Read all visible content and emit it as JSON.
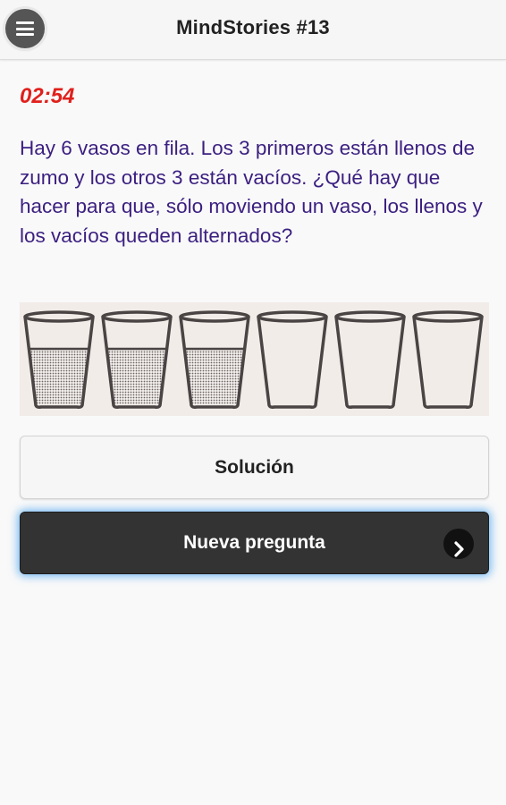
{
  "header": {
    "title": "MindStories #13",
    "menu_icon": "hamburger-menu-icon"
  },
  "timer": "02:54",
  "question": "Hay 6 vasos en fila. Los 3 primeros están llenos de zumo y los otros 3 están vacíos. ¿Qué hay que hacer para que, sólo moviendo un vaso, los llenos y los vacíos queden alternados?",
  "illustration": {
    "glasses": [
      {
        "filled": true
      },
      {
        "filled": true
      },
      {
        "filled": true
      },
      {
        "filled": false
      },
      {
        "filled": false
      },
      {
        "filled": false
      }
    ]
  },
  "buttons": {
    "solution_label": "Solución",
    "next_label": "Nueva pregunta",
    "next_icon": "chevron-right-icon"
  },
  "colors": {
    "timer": "#e0201c",
    "question_text": "#3b1f80",
    "primary_button": "#333333",
    "focus_glow": "#40a0f0"
  }
}
